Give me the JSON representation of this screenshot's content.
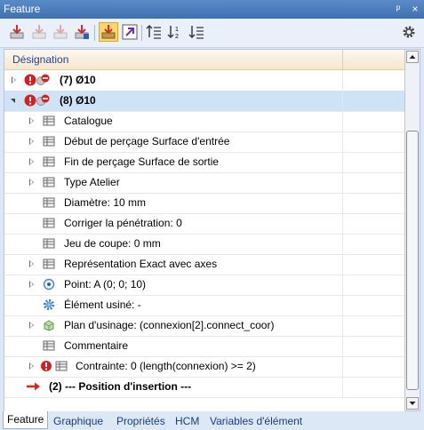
{
  "window": {
    "title": "Feature",
    "pin_glyph": "ᵖ",
    "close_glyph": "×"
  },
  "toolbar": {
    "icons": [
      "insert-feature-icon",
      "insert-disabled-icon",
      "insert-disabled-icon",
      "insert-red-icon",
      "insert-highlight-icon",
      "link-arrow-icon",
      "sort-up-icon",
      "sort-numbers-icon",
      "sort-down-icon"
    ],
    "settings_icon": "gear-icon"
  },
  "tree": {
    "column_header": "Désignation",
    "rows": [
      {
        "label": "(7)  Ø10"
      },
      {
        "label": "(8)  Ø10"
      },
      {
        "label": "Catalogue"
      },
      {
        "label": "Début de perçage Surface d'entrée"
      },
      {
        "label": "Fin de perçage Surface de sortie"
      },
      {
        "label": "Type Atelier"
      },
      {
        "label": "Diamètre: 10 mm"
      },
      {
        "label": "Corriger la pénétration: 0"
      },
      {
        "label": "Jeu de coupe: 0 mm"
      },
      {
        "label": "Représentation  Exact avec axes"
      },
      {
        "label": "Point: A  (0; 0; 10)"
      },
      {
        "label": "Élément usiné: -"
      },
      {
        "label": "Plan d'usinage: (connexion[2].connect_coor)"
      },
      {
        "label": "Commentaire"
      },
      {
        "label": "Contrainte: 0 (length(connexion) >= 2)"
      },
      {
        "label": "(2) --- Position  d'insertion ---"
      }
    ]
  },
  "tabs": [
    "Feature",
    "Graphique",
    "Propriétés",
    "HCM",
    "Variables d'élément"
  ],
  "colors": {
    "accent": "#3f70b2",
    "selected_row": "#cfe3f7",
    "header_bg": "#f6e7cd",
    "error_red": "#d81e1e",
    "arrow_red": "#e0201b"
  }
}
